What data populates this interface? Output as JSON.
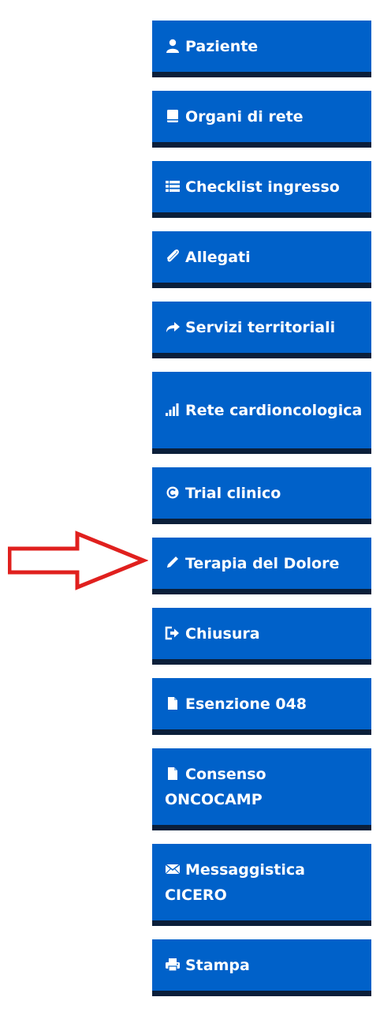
{
  "menu": {
    "items": [
      {
        "label": "Paziente",
        "icon": "user-icon"
      },
      {
        "label": "Organi di rete",
        "icon": "book-icon"
      },
      {
        "label": "Checklist ingresso",
        "icon": "list-icon"
      },
      {
        "label": "Allegati",
        "icon": "paperclip-icon"
      },
      {
        "label": "Servizi territoriali",
        "icon": "share-arrow-icon"
      },
      {
        "label": "Rete cardioncologica",
        "icon": "signal-bars-icon"
      },
      {
        "label": "Trial clinico",
        "icon": "copyright-circle-icon"
      },
      {
        "label": "Terapia del Dolore",
        "icon": "pencil-icon"
      },
      {
        "label": "Chiusura",
        "icon": "logout-icon"
      },
      {
        "label": "Esenzione 048",
        "icon": "file-icon"
      },
      {
        "label": "Consenso ONCOCAMP",
        "icon": "file-icon"
      },
      {
        "label": "Messaggistica CICERO",
        "icon": "envelope-icon"
      },
      {
        "label": "Stampa",
        "icon": "printer-icon"
      }
    ]
  },
  "colors": {
    "button_bg": "#0061c9",
    "button_border": "#0b1f3a",
    "button_text": "#ffffff",
    "arrow": "#e0201e"
  },
  "annotation": {
    "icon": "red-outline-arrow-icon",
    "target_item_index": 7
  }
}
